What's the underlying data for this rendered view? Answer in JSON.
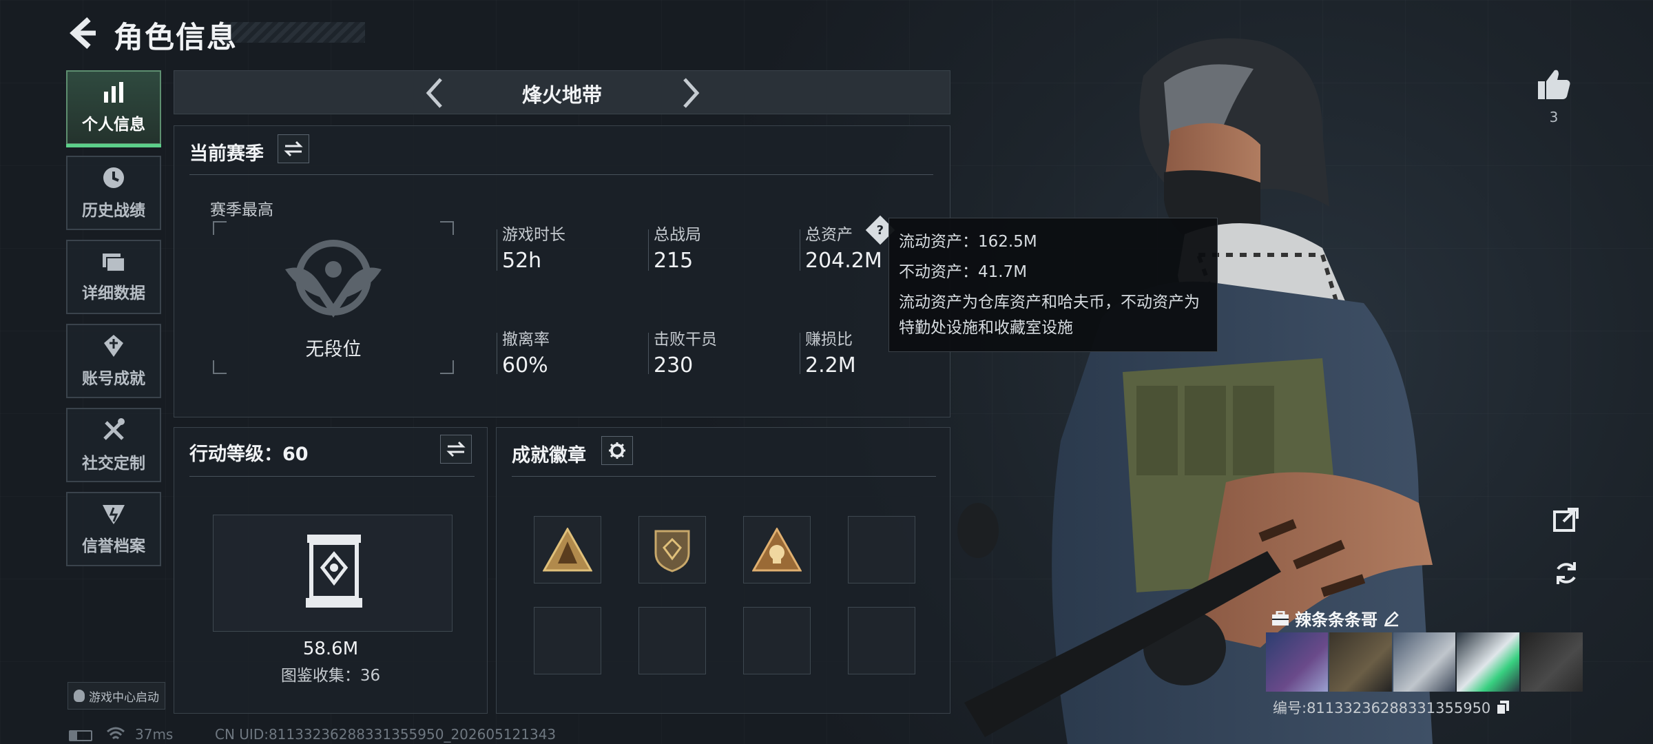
{
  "header": {
    "title": "角色信息"
  },
  "sidebar": {
    "items": [
      {
        "label": "个人信息",
        "icon": "bar-chart-icon",
        "active": true
      },
      {
        "label": "历史战绩",
        "icon": "clock-icon"
      },
      {
        "label": "详细数据",
        "icon": "folder-icon"
      },
      {
        "label": "账号成就",
        "icon": "achievement-icon"
      },
      {
        "label": "社交定制",
        "icon": "tools-icon"
      },
      {
        "label": "信誉档案",
        "icon": "shield-icon"
      }
    ],
    "game_center_label": "游戏中心启动"
  },
  "map_selector": {
    "name": "烽火地带"
  },
  "season": {
    "title": "当前赛季",
    "best_label": "赛季最高",
    "rank_text": "无段位",
    "stats": [
      {
        "label": "游戏时长",
        "value": "52h"
      },
      {
        "label": "总战局",
        "value": "215"
      },
      {
        "label": "总资产",
        "value": "204.2M"
      },
      {
        "label": "撤离率",
        "value": "60%"
      },
      {
        "label": "击败干员",
        "value": "230"
      },
      {
        "label": "赚损比",
        "value": "2.2M"
      }
    ]
  },
  "tooltip": {
    "liquid": "流动资产：162.5M",
    "fixed": "不动资产：41.7M",
    "desc": "流动资产为仓库资产和哈夫币，不动资产为特勤处设施和收藏室设施"
  },
  "action_level": {
    "title": "行动等级：60",
    "value": "58.6M",
    "collection": "图鉴收集：36"
  },
  "badges": {
    "title": "成就徽章"
  },
  "right": {
    "like_count": "3",
    "player_name": "辣条条条哥",
    "player_id": "编号:81133236288331355950"
  },
  "status": {
    "ping": "37ms",
    "uid": "CN UID:81133236288331355950_202605121343"
  }
}
